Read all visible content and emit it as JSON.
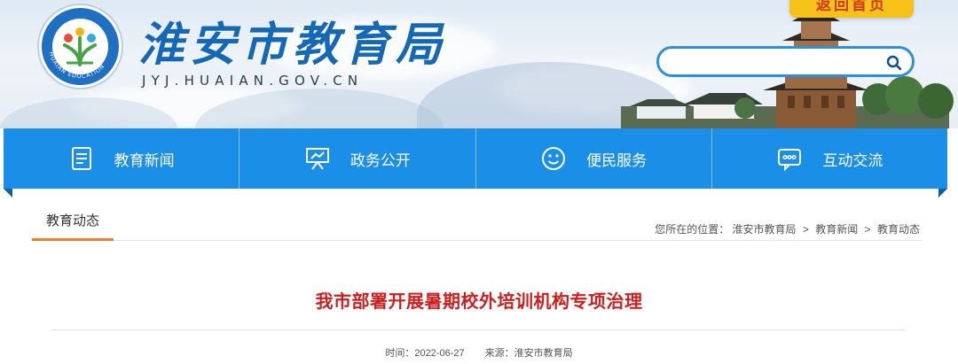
{
  "header": {
    "site_title": "淮安市教育局",
    "site_domain": "JYJ.HUAIAN.GOV.CN",
    "home_button": "返回首页",
    "logo_ring_text": "HUAIAN EDUCATION",
    "search": {
      "value": "",
      "placeholder": ""
    }
  },
  "nav": {
    "items": [
      {
        "label": "教育新闻",
        "icon": "document-icon"
      },
      {
        "label": "政务公开",
        "icon": "presentation-icon"
      },
      {
        "label": "便民服务",
        "icon": "smiley-icon"
      },
      {
        "label": "互动交流",
        "icon": "chat-bubble-icon"
      }
    ]
  },
  "section": {
    "tab_label": "教育动态",
    "breadcrumb": {
      "prefix": "您所在的位置：",
      "items": [
        "淮安市教育局",
        "教育新闻",
        "教育动态"
      ],
      "separator": ">"
    }
  },
  "article": {
    "title": "我市部署开展暑期校外培训机构专项治理",
    "time_label": "时间：2022-06-27",
    "source_label": "来源：淮安市教育局"
  },
  "colors": {
    "nav_blue": "#1b8fe8",
    "title_red": "#cc1f1f",
    "accent_orange": "#ef7d2b",
    "home_yellow": "#f6c21a"
  }
}
